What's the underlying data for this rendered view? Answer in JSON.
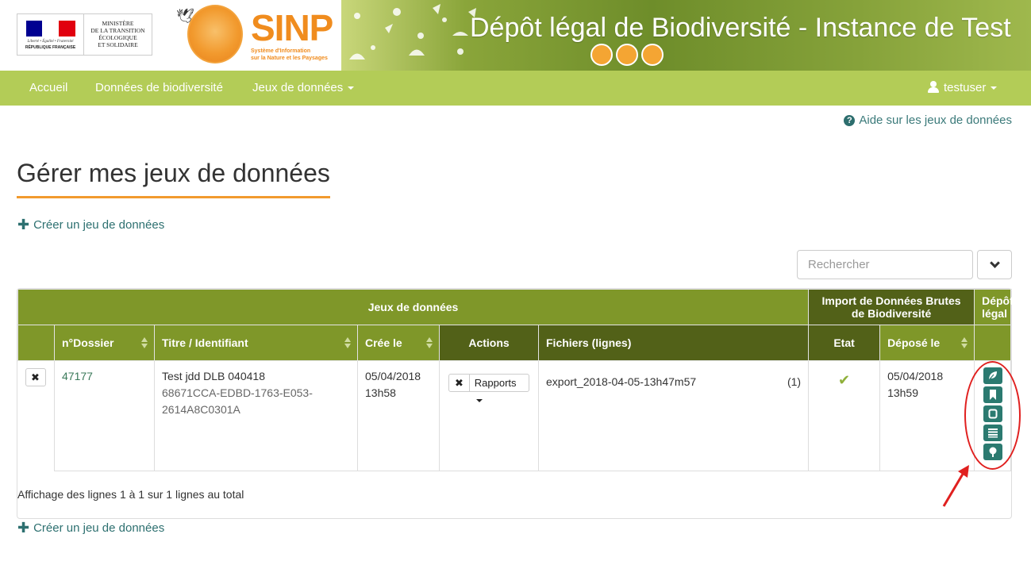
{
  "header": {
    "gov_logo": {
      "motto": "Liberté • Égalité • Fraternité",
      "republic": "RÉPUBLIQUE FRANÇAISE",
      "ministry_lines": [
        "MINISTÈRE",
        "DE LA TRANSITION",
        "ÉCOLOGIQUE",
        "ET SOLIDAIRE"
      ],
      "flag_colors": [
        "#000091",
        "#ffffff",
        "#e1000f"
      ]
    },
    "sinp_logo": {
      "name": "SINP",
      "subtitle_lines": [
        "Système d'Information",
        "sur la Nature et les Paysages"
      ]
    },
    "title": "Dépôt légal de Biodiversité - Instance de Test"
  },
  "nav": {
    "items": [
      "Accueil",
      "Données de biodiversité",
      "Jeux de données"
    ],
    "user": "testuser"
  },
  "help_link": "Aide sur les jeux de données",
  "page_title": "Gérer mes jeux de données",
  "create_label": "Créer un jeu de données",
  "search": {
    "placeholder": "Rechercher"
  },
  "table": {
    "group_headers": [
      "Jeux de données",
      "Import de Données Brutes de Biodiversité",
      "Dépôt légal"
    ],
    "columns": [
      "n°Dossier",
      "Titre / Identifiant",
      "Crée le",
      "Actions",
      "Fichiers (lignes)",
      "Etat",
      "Déposé le"
    ],
    "rows": [
      {
        "dossier": "47177",
        "title": "Test jdd DLB 040418",
        "identifier": "68671CCA-EDBD-1763-E053-2614A8C0301A",
        "created": "05/04/2018 13h58",
        "rapports_label": "Rapports",
        "file": "export_2018-04-05-13h47m57",
        "file_lines": "(1)",
        "deposited": "05/04/2018 13h59",
        "action_icons": [
          "leaf-icon",
          "bookmark-icon",
          "square-icon",
          "list-icon",
          "tree-icon"
        ]
      }
    ]
  },
  "footer_info": "Affichage des lignes 1 à 1 sur 1 lignes au total",
  "colors": {
    "nav_bg": "#b3cc57",
    "header_group_1": "#7f9729",
    "header_group_2": "#526118",
    "accent_orange": "#f29a2e",
    "link_teal": "#2d7070",
    "annotation_red": "#e0201f"
  }
}
